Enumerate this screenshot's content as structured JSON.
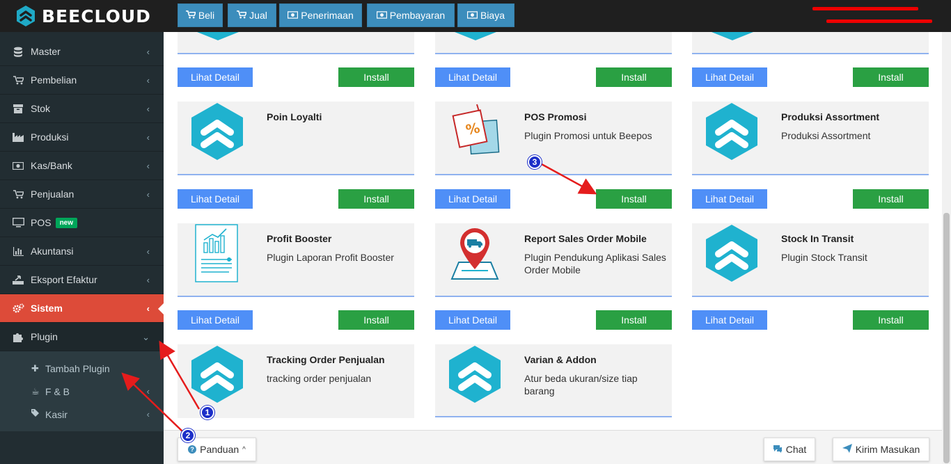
{
  "brand": {
    "name": "BEECLOUD"
  },
  "topbar": {
    "buttons": [
      {
        "label": "Beli",
        "icon": "cart-icon"
      },
      {
        "label": "Jual",
        "icon": "cart-icon"
      },
      {
        "label": "Penerimaan",
        "icon": "money-icon"
      },
      {
        "label": "Pembayaran",
        "icon": "money-icon"
      },
      {
        "label": "Biaya",
        "icon": "money-icon"
      }
    ]
  },
  "sidebar": {
    "items": [
      {
        "label": "Master",
        "icon": "database-icon"
      },
      {
        "label": "Pembelian",
        "icon": "cart-icon"
      },
      {
        "label": "Stok",
        "icon": "box-icon"
      },
      {
        "label": "Produksi",
        "icon": "industry-icon"
      },
      {
        "label": "Kas/Bank",
        "icon": "money-icon"
      },
      {
        "label": "Penjualan",
        "icon": "cart-icon"
      },
      {
        "label": "POS",
        "icon": "monitor-icon",
        "badge": "new"
      },
      {
        "label": "Akuntansi",
        "icon": "bar-chart-icon"
      },
      {
        "label": "Eksport Efaktur",
        "icon": "export-icon"
      },
      {
        "label": "Sistem",
        "icon": "gears-icon",
        "active": true
      },
      {
        "label": "Plugin",
        "icon": "puzzle-icon",
        "open": true
      }
    ],
    "submenu": [
      {
        "label": "Tambah Plugin",
        "icon": "plus-icon"
      },
      {
        "label": "F & B",
        "icon": "coffee-icon"
      },
      {
        "label": "Kasir",
        "icon": "tags-icon"
      }
    ]
  },
  "plugins": {
    "top_row": [
      {
        "detail_label": "Lihat Detail",
        "install_label": "Install"
      },
      {
        "detail_label": "Lihat Detail",
        "install_label": "Install"
      },
      {
        "detail_label": "Lihat Detail",
        "install_label": "Install"
      }
    ],
    "cards": [
      {
        "title": "Poin Loyalti",
        "desc": "",
        "image": "beecloud-logo-icon",
        "detail_label": "Lihat Detail",
        "install_label": "Install"
      },
      {
        "title": "POS Promosi",
        "desc": "Plugin Promosi untuk Beepos",
        "image": "promo-tag-icon",
        "detail_label": "Lihat Detail",
        "install_label": "Install"
      },
      {
        "title": "Produksi Assortment",
        "desc": "Produksi Assortment",
        "image": "beecloud-logo-icon",
        "detail_label": "Lihat Detail",
        "install_label": "Install"
      },
      {
        "title": "Profit Booster",
        "desc": "Plugin Laporan Profit Booster",
        "image": "report-chart-icon",
        "detail_label": "Lihat Detail",
        "install_label": "Install"
      },
      {
        "title": "Report Sales Order Mobile",
        "desc": "Plugin Pendukung Aplikasi Sales Order Mobile",
        "image": "map-pin-truck-icon",
        "detail_label": "Lihat Detail",
        "install_label": "Install"
      },
      {
        "title": "Stock In Transit",
        "desc": "Plugin Stock Transit",
        "image": "beecloud-logo-icon",
        "detail_label": "Lihat Detail",
        "install_label": "Install"
      },
      {
        "title": "Tracking Order Penjualan",
        "desc": "tracking order penjualan",
        "image": "beecloud-logo-icon"
      },
      {
        "title": "Varian & Addon",
        "desc": "Atur beda ukuran/size tiap barang",
        "image": "beecloud-logo-icon"
      }
    ]
  },
  "bottombar": {
    "panduan_label": "Panduan",
    "chat_label": "Chat",
    "feedback_label": "Kirim Masukan"
  },
  "annotations": {
    "markers": [
      "1",
      "2",
      "3"
    ],
    "arrow_color": "#e51c1c"
  },
  "colors": {
    "accent": "#3c8dbc",
    "active": "#dd4b39",
    "install": "#2aa043",
    "detail": "#4f8ff7",
    "sidebar": "#222d32"
  }
}
